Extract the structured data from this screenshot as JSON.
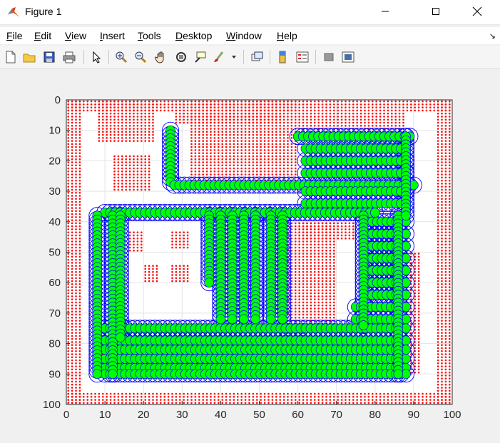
{
  "window": {
    "title": "Figure 1"
  },
  "menu": [
    {
      "label": "File",
      "u": "F",
      "rest": "ile"
    },
    {
      "label": "Edit",
      "u": "E",
      "rest": "dit"
    },
    {
      "label": "View",
      "u": "V",
      "rest": "iew"
    },
    {
      "label": "Insert",
      "u": "I",
      "rest": "nsert"
    },
    {
      "label": "Tools",
      "u": "T",
      "rest": "ools"
    },
    {
      "label": "Desktop",
      "u": "D",
      "rest": "esktop"
    },
    {
      "label": "Window",
      "u": "W",
      "rest": "indow"
    },
    {
      "label": "Help",
      "u": "H",
      "rest": "elp"
    }
  ],
  "toolbar": [
    "new-figure-icon",
    "open-file-icon",
    "save-icon",
    "print-icon",
    "pointer-icon",
    "zoom-in-icon",
    "zoom-out-icon",
    "pan-icon",
    "rotate-3d-icon",
    "data-cursor-icon",
    "brush-icon",
    "link-plot-icon",
    "colorbar-icon",
    "legend-icon",
    "hide-plot-tools-icon",
    "show-plot-tools-icon"
  ],
  "colors": {
    "free_space": "#ffffff",
    "obstacle": "#ff0000",
    "path_circle": "#0000ff",
    "path_fill": "#00ff00",
    "grid": "#e3e3e3"
  },
  "chart_data": {
    "type": "scatter",
    "title": "",
    "xlabel": "",
    "ylabel": "",
    "xlim": [
      0,
      100
    ],
    "ylim": [
      0,
      100
    ],
    "y_reversed": true,
    "grid": true,
    "xticks": [
      "0",
      "10",
      "20",
      "30",
      "40",
      "50",
      "60",
      "70",
      "80",
      "90",
      "100"
    ],
    "yticks": [
      "0",
      "10",
      "20",
      "30",
      "40",
      "50",
      "60",
      "70",
      "80",
      "90",
      "100"
    ],
    "obstacle_regions": [
      {
        "x": [
          0,
          100
        ],
        "y": [
          0,
          4
        ]
      },
      {
        "x": [
          0,
          100
        ],
        "y": [
          96,
          100
        ]
      },
      {
        "x": [
          0,
          4
        ],
        "y": [
          0,
          100
        ]
      },
      {
        "x": [
          96,
          100
        ],
        "y": [
          0,
          100
        ]
      },
      {
        "x": [
          8,
          23
        ],
        "y": [
          0,
          14
        ]
      },
      {
        "x": [
          32,
          60
        ],
        "y": [
          0,
          28
        ]
      },
      {
        "x": [
          60,
          88
        ],
        "y": [
          4,
          12
        ]
      },
      {
        "x": [
          28,
          56
        ],
        "y": [
          4,
          8
        ]
      },
      {
        "x": [
          12,
          22
        ],
        "y": [
          18,
          30
        ]
      },
      {
        "x": [
          16,
          20
        ],
        "y": [
          43,
          50
        ]
      },
      {
        "x": [
          20,
          24
        ],
        "y": [
          54,
          60
        ]
      },
      {
        "x": [
          27,
          32
        ],
        "y": [
          43,
          49
        ]
      },
      {
        "x": [
          27,
          32
        ],
        "y": [
          54,
          60
        ]
      },
      {
        "x": [
          55,
          70
        ],
        "y": [
          40,
          74
        ]
      },
      {
        "x": [
          60,
          75
        ],
        "y": [
          40,
          46
        ]
      },
      {
        "x": [
          55,
          62
        ],
        "y": [
          74,
          80
        ]
      },
      {
        "x": [
          88,
          92
        ],
        "y": [
          50,
          90
        ]
      },
      {
        "x": [
          8,
          10
        ],
        "y": [
          76,
          84
        ]
      }
    ],
    "path_segments": [
      {
        "x": [
          27,
          27
        ],
        "y": [
          10,
          27
        ]
      },
      {
        "x": [
          28,
          90
        ],
        "y": [
          28,
          28
        ]
      },
      {
        "x": [
          60,
          89
        ],
        "y": [
          12,
          12
        ]
      },
      {
        "x": [
          62,
          88
        ],
        "y": [
          16,
          16
        ]
      },
      {
        "x": [
          62,
          88
        ],
        "y": [
          20,
          20
        ]
      },
      {
        "x": [
          62,
          88
        ],
        "y": [
          24,
          24
        ]
      },
      {
        "x": [
          62,
          88
        ],
        "y": [
          30,
          30
        ]
      },
      {
        "x": [
          62,
          88
        ],
        "y": [
          34,
          34
        ]
      },
      {
        "x": [
          10,
          80
        ],
        "y": [
          37,
          37
        ]
      },
      {
        "x": [
          78,
          88
        ],
        "y": [
          40,
          40
        ]
      },
      {
        "x": [
          78,
          88
        ],
        "y": [
          44,
          44
        ]
      },
      {
        "x": [
          78,
          88
        ],
        "y": [
          48,
          48
        ]
      },
      {
        "x": [
          78,
          88
        ],
        "y": [
          52,
          52
        ]
      },
      {
        "x": [
          78,
          88
        ],
        "y": [
          56,
          56
        ]
      },
      {
        "x": [
          78,
          88
        ],
        "y": [
          60,
          60
        ]
      },
      {
        "x": [
          78,
          88
        ],
        "y": [
          64,
          64
        ]
      },
      {
        "x": [
          75,
          88
        ],
        "y": [
          68,
          68
        ]
      },
      {
        "x": [
          75,
          88
        ],
        "y": [
          72,
          72
        ]
      },
      {
        "x": [
          10,
          88
        ],
        "y": [
          75,
          75
        ]
      },
      {
        "x": [
          10,
          88
        ],
        "y": [
          79,
          79
        ]
      },
      {
        "x": [
          10,
          88
        ],
        "y": [
          82,
          82
        ]
      },
      {
        "x": [
          10,
          88
        ],
        "y": [
          85,
          85
        ]
      },
      {
        "x": [
          10,
          88
        ],
        "y": [
          88,
          88
        ]
      },
      {
        "x": [
          10,
          88
        ],
        "y": [
          90,
          90
        ]
      },
      {
        "x": [
          8,
          8
        ],
        "y": [
          38,
          90
        ]
      },
      {
        "x": [
          12,
          12
        ],
        "y": [
          38,
          90
        ]
      },
      {
        "x": [
          14,
          14
        ],
        "y": [
          38,
          78
        ]
      },
      {
        "x": [
          37,
          37
        ],
        "y": [
          38,
          60
        ]
      },
      {
        "x": [
          40,
          40
        ],
        "y": [
          38,
          72
        ]
      },
      {
        "x": [
          43,
          43
        ],
        "y": [
          38,
          72
        ]
      },
      {
        "x": [
          46,
          46
        ],
        "y": [
          38,
          72
        ]
      },
      {
        "x": [
          49,
          49
        ],
        "y": [
          38,
          72
        ]
      },
      {
        "x": [
          53,
          53
        ],
        "y": [
          38,
          72
        ]
      },
      {
        "x": [
          56,
          56
        ],
        "y": [
          38,
          72
        ]
      },
      {
        "x": [
          77,
          77
        ],
        "y": [
          38,
          74
        ]
      },
      {
        "x": [
          86,
          86
        ],
        "y": [
          38,
          90
        ]
      },
      {
        "x": [
          88,
          88
        ],
        "y": [
          12,
          38
        ]
      }
    ]
  }
}
